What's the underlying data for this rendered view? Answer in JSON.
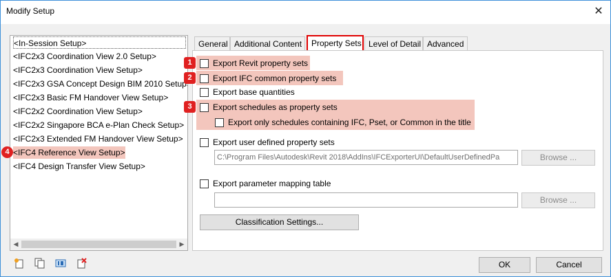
{
  "window": {
    "title": "Modify Setup",
    "close_glyph": "✕"
  },
  "setups": [
    "<In-Session Setup>",
    "<IFC2x3 Coordination View 2.0 Setup>",
    "<IFC2x3 Coordination View Setup>",
    "<IFC2x3 GSA Concept Design BIM 2010 Setup>",
    "<IFC2x3 Basic FM Handover View Setup>",
    "<IFC2x2 Coordination View Setup>",
    "<IFC2x2 Singapore BCA e-Plan Check Setup>",
    "<IFC2x3 Extended FM Handover View Setup>",
    "<IFC4 Reference View Setup>",
    "<IFC4 Design Transfer View Setup>"
  ],
  "scroll_arrows": {
    "left": "◀",
    "right": "▶"
  },
  "tabs": [
    "General",
    "Additional Content",
    "Property Sets",
    "Level of Detail",
    "Advanced"
  ],
  "active_tab": "Property Sets",
  "options": {
    "revit_psets": "Export Revit property sets",
    "ifc_common_psets": "Export IFC common property sets",
    "base_quantities": "Export base quantities",
    "schedules_psets": "Export schedules as property sets",
    "schedules_only": "Export only schedules containing IFC, Pset, or Common in the title",
    "user_defined_psets": "Export user defined property sets",
    "user_defined_path": "C:\\Program Files\\Autodesk\\Revit 2018\\AddIns\\IFCExporterUI\\DefaultUserDefinedPa",
    "param_mapping": "Export parameter mapping table",
    "param_mapping_path": ""
  },
  "buttons": {
    "browse": "Browse ...",
    "classification": "Classification Settings...",
    "ok": "OK",
    "cancel": "Cancel"
  },
  "badges": [
    "1",
    "2",
    "3",
    "4"
  ],
  "colors": {
    "highlight": "#f3c6bd",
    "badge": "#e02020",
    "active_tab_border": "#e00000"
  }
}
